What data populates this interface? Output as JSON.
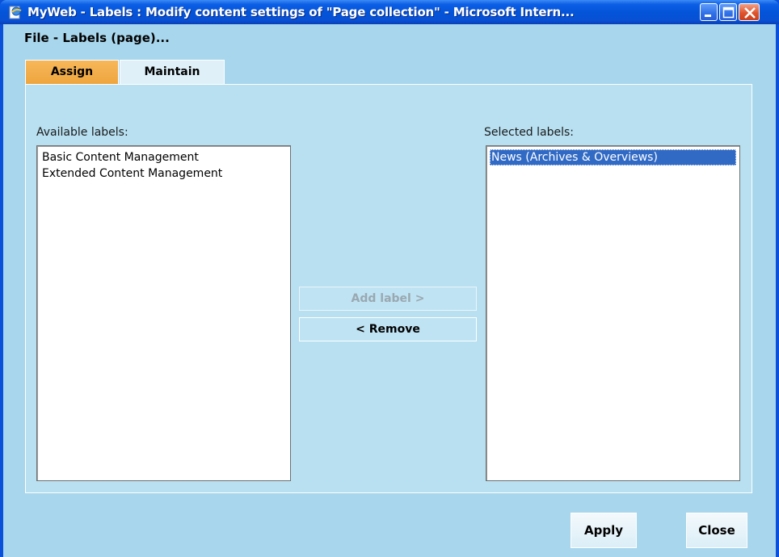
{
  "window": {
    "title": "MyWeb - Labels : Modify content settings of \"Page collection\" - Microsoft Intern...",
    "icon": "ie-page-icon",
    "controls": [
      "minimize-icon",
      "maximize-icon",
      "close-icon"
    ]
  },
  "header": {
    "file_caption": "File - Labels (page)..."
  },
  "tabs": [
    {
      "label": "Assign",
      "active": true
    },
    {
      "label": "Maintain",
      "active": false
    }
  ],
  "assign": {
    "available_label": "Available labels:",
    "selected_label": "Selected labels:",
    "available_items": [
      "Basic Content Management",
      "Extended Content Management"
    ],
    "selected_items": [
      "News (Archives & Overviews)"
    ],
    "add_button": "Add label >",
    "remove_button": "< Remove"
  },
  "footer": {
    "apply_label": "Apply",
    "close_label": "Close"
  },
  "colors": {
    "titlebar": "#0454d9",
    "client_bg": "#a8d6ec",
    "active_tab": "#eea53e",
    "selection": "#316ac5"
  }
}
